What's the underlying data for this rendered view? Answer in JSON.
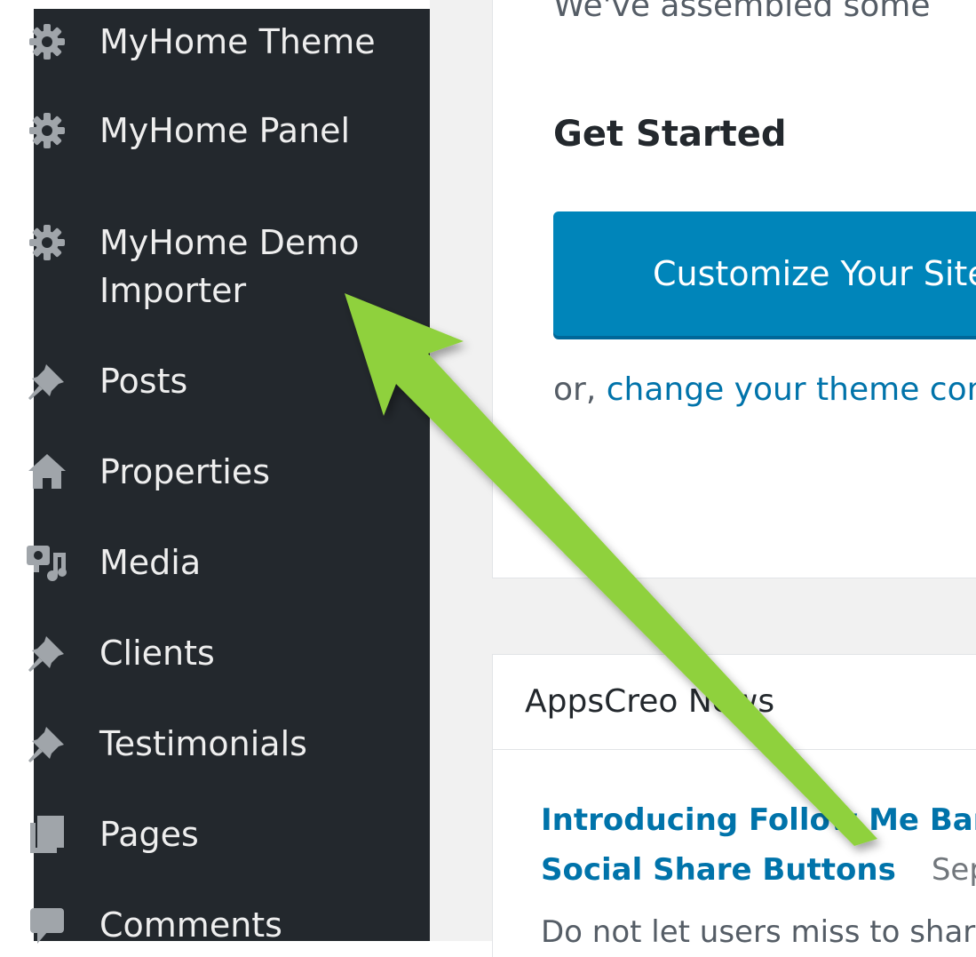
{
  "sidebar": {
    "items": [
      {
        "label": "MyHome Theme",
        "icon": "gear-icon"
      },
      {
        "label": "MyHome Panel",
        "icon": "gear-icon"
      },
      {
        "label": "MyHome Demo",
        "label2": "Importer",
        "icon": "gear-icon"
      },
      {
        "label": "Posts",
        "icon": "pushpin-icon"
      },
      {
        "label": "Properties",
        "icon": "home-icon"
      },
      {
        "label": "Media",
        "icon": "media-icon"
      },
      {
        "label": "Clients",
        "icon": "pushpin-icon"
      },
      {
        "label": "Testimonials",
        "icon": "pushpin-icon"
      },
      {
        "label": "Pages",
        "icon": "pages-icon"
      },
      {
        "label": "Comments",
        "icon": "comment-icon"
      }
    ]
  },
  "welcome": {
    "intro_text": "We've assembled some",
    "heading": "Get Started",
    "button_label": "Customize Your Site",
    "alt_prefix": "or,",
    "alt_link": "change your theme com"
  },
  "news": {
    "title": "AppsCreo News",
    "item_title_line1": "Introducing Follow Me Bar:",
    "item_title_line2": "Social Share Buttons",
    "item_date": "Sept",
    "item_excerpt": "Do not let users miss to shar"
  },
  "colors": {
    "sidebar_bg": "#23282d",
    "button_bg": "#0085ba",
    "link": "#0073aa",
    "arrow": "#8fd13c"
  }
}
